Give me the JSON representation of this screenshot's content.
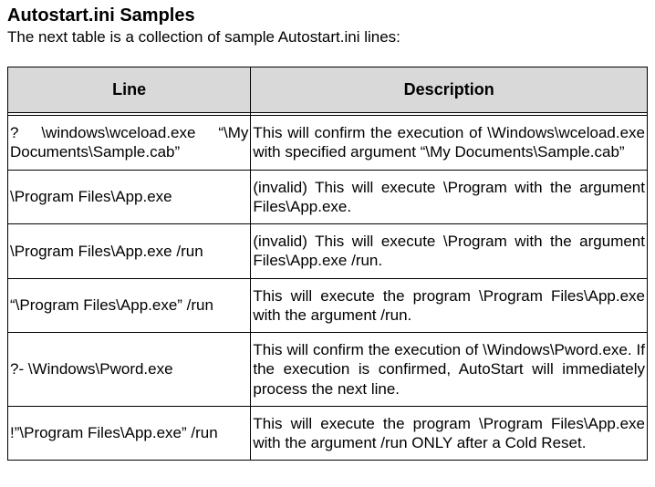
{
  "title": "Autostart.ini Samples",
  "subtitle": "The next table is a collection of sample Autostart.ini lines:",
  "table": {
    "headers": {
      "line": "Line",
      "description": "Description"
    },
    "rows": [
      {
        "line": "? \\windows\\wceload.exe “\\My Documents\\Sample.cab”",
        "description": "This will confirm the execution of \\Windows\\wceload.exe with specified argument “\\My Documents\\Sample.cab”"
      },
      {
        "line": "\\Program Files\\App.exe",
        "description": "(invalid) This will execute \\Program with the argument Files\\App.exe."
      },
      {
        "line": "\\Program Files\\App.exe /run",
        "description": "(invalid) This will execute \\Program with the argument Files\\App.exe /run."
      },
      {
        "line": "“\\Program Files\\App.exe” /run",
        "description": "This will execute the program \\Program Files\\App.exe with the argument /run."
      },
      {
        "line": "?- \\Windows\\Pword.exe",
        "description": "This will confirm the execution of \\Windows\\Pword.exe. If the execution is confirmed, AutoStart will immediately process the next line."
      },
      {
        "line": "!”\\Program Files\\App.exe” /run",
        "description": "This will execute the program \\Program Files\\App.exe with the argument /run ONLY after a Cold Reset."
      }
    ]
  }
}
